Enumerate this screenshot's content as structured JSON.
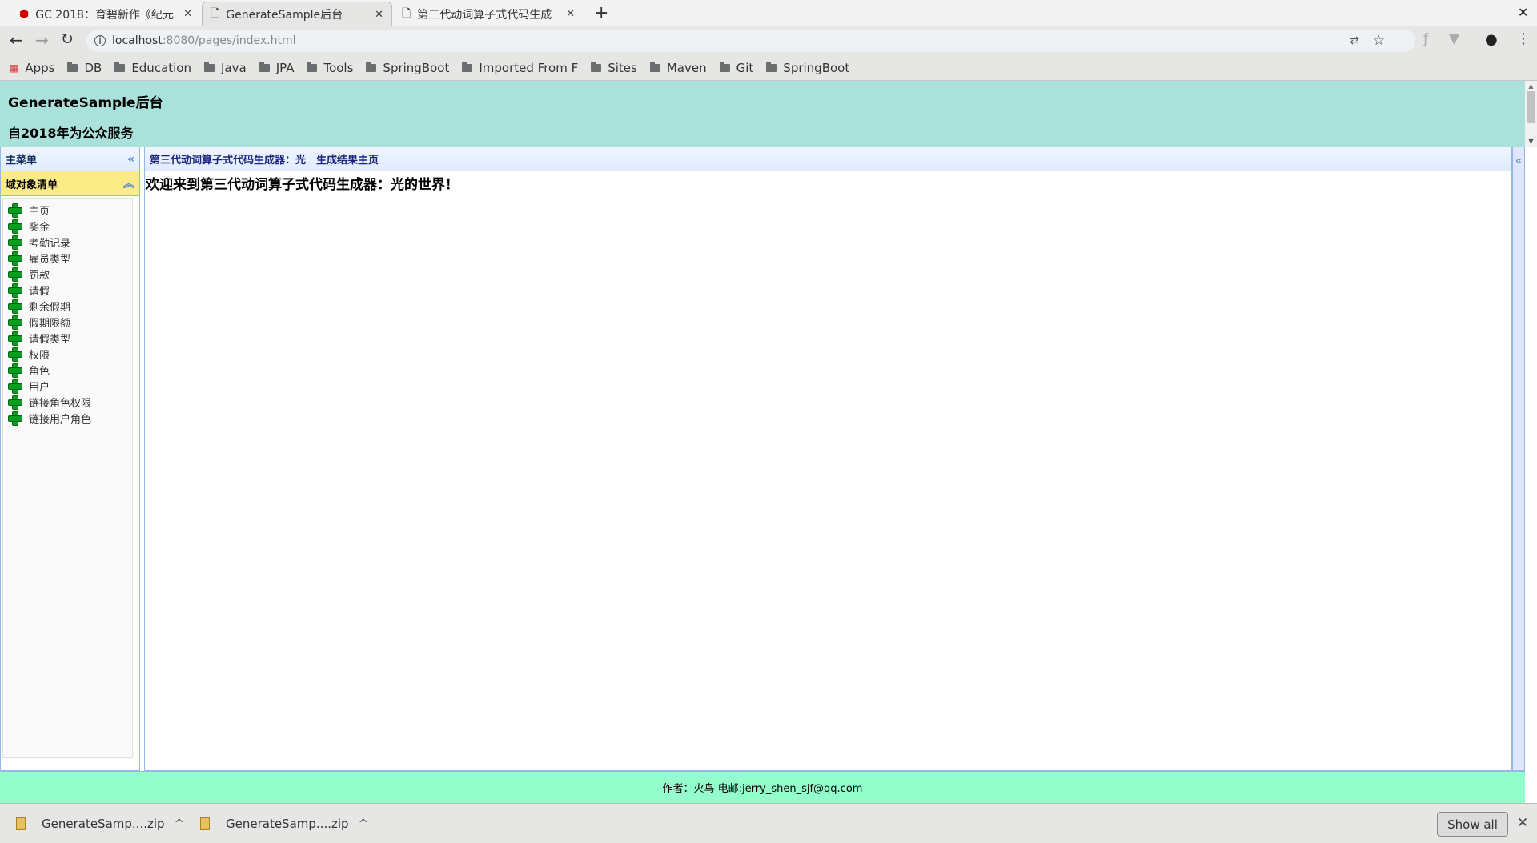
{
  "browser": {
    "tabs": [
      {
        "label": "GC 2018：育碧新作《纪元",
        "icon": "game-favicon"
      },
      {
        "label": "GenerateSample后台",
        "icon": "page-icon",
        "active": true
      },
      {
        "label": "第三代动词算子式代码生成",
        "icon": "page-icon"
      }
    ],
    "url_host": "localhost",
    "url_rest": ":8080/pages/index.html",
    "bookmarks": [
      "Apps",
      "DB",
      "Education",
      "Java",
      "JPA",
      "Tools",
      "SpringBoot",
      "Imported From F",
      "Sites",
      "Maven",
      "Git",
      "SpringBoot"
    ]
  },
  "header": {
    "title": "GenerateSample后台",
    "subtitle": "自2018年为公众服务"
  },
  "sidebar": {
    "title": "主菜单",
    "section": "域对象清单",
    "items": [
      "主页",
      "奖金",
      "考勤记录",
      "雇员类型",
      "罚款",
      "请假",
      "剩余假期",
      "假期限额",
      "请假类型",
      "权限",
      "角色",
      "用户",
      "链接角色权限",
      "链接用户角色"
    ]
  },
  "main": {
    "breadcrumb": "第三代动词算子式代码生成器：光　生成结果主页",
    "welcome": "欢迎来到第三代动词算子式代码生成器：光的世界！"
  },
  "footer": {
    "text": "作者：火鸟 电邮:jerry_shen_sjf@qq.com"
  },
  "downloads": {
    "items": [
      "GenerateSamp....zip",
      "GenerateSamp....zip"
    ],
    "show_all": "Show all"
  }
}
